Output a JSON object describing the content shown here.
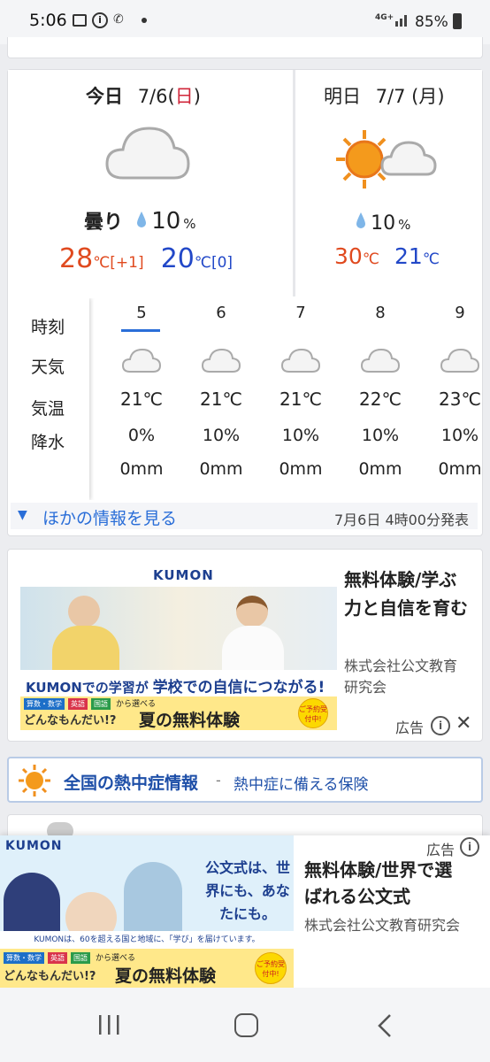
{
  "status_bar": {
    "time": "5:06",
    "network": "4G+",
    "battery": "85%"
  },
  "today": {
    "label": "今日",
    "date": "7/6",
    "dow_open": "(",
    "dow": "日",
    "dow_close": ")",
    "condition": "曇り",
    "rain": "10",
    "rain_unit": "%",
    "high": "28",
    "high_unit": "℃",
    "high_diff": "[+1]",
    "low": "20",
    "low_unit": "℃",
    "low_diff": "[0]"
  },
  "tomorrow": {
    "label": "明日",
    "date": "7/7 (月)",
    "rain": "10",
    "rain_unit": "%",
    "high": "30",
    "high_unit": "℃",
    "low": "21",
    "low_unit": "℃"
  },
  "hourly": {
    "row_labels": [
      "時刻",
      "天気",
      "気温",
      "降水"
    ],
    "hours": [
      {
        "hour": "5",
        "temp": "21℃",
        "pop": "0%",
        "mm": "0mm"
      },
      {
        "hour": "6",
        "temp": "21℃",
        "pop": "10%",
        "mm": "0mm"
      },
      {
        "hour": "7",
        "temp": "21℃",
        "pop": "10%",
        "mm": "0mm"
      },
      {
        "hour": "8",
        "temp": "22℃",
        "pop": "10%",
        "mm": "0mm"
      },
      {
        "hour": "9",
        "temp": "23℃",
        "pop": "10%",
        "mm": "0mm"
      }
    ]
  },
  "more_info": {
    "link": "ほかの情報を見る",
    "issued": "7月6日 4時00分発表"
  },
  "ad1": {
    "brand": "KUMON",
    "banner_line": "KUMONでの学習が",
    "banner_highlight": "学校での自信につながる!",
    "subjects": [
      "算数・数学",
      "英語",
      "国語"
    ],
    "subjects_suffix": "から選べる",
    "campaign": "どんなもんだい!?",
    "campaign_main": "夏の無料体験",
    "badge": "ご予約受付中!",
    "title": "無料体験/学ぶ力と自信を育む",
    "advertiser": "株式会社公文教育研究会",
    "ad_label": "広告"
  },
  "heat": {
    "title": "全国の熱中症情報",
    "sep": " - ",
    "subtitle": "熱中症に備える保険"
  },
  "ad2": {
    "brand": "KUMON",
    "copy": "公文式は、世界にも、あなたにも。",
    "footer_line": "KUMONは、60を超える国と地域に、「学び」を届けています。",
    "subjects": [
      "算数・数学",
      "英語",
      "国語"
    ],
    "subjects_suffix": "から選べる",
    "campaign": "どんなもんだい!?",
    "campaign_main": "夏の無料体験",
    "badge": "ご予約受付中!",
    "title": "無料体験/世界で選ばれる公文式",
    "advertiser": "株式会社公文教育研究会",
    "ad_label": "広告"
  },
  "colors": {
    "high": "#e04a1f",
    "low": "#2248c8",
    "accent": "#2a6ed8",
    "sun": "#f0901e"
  }
}
